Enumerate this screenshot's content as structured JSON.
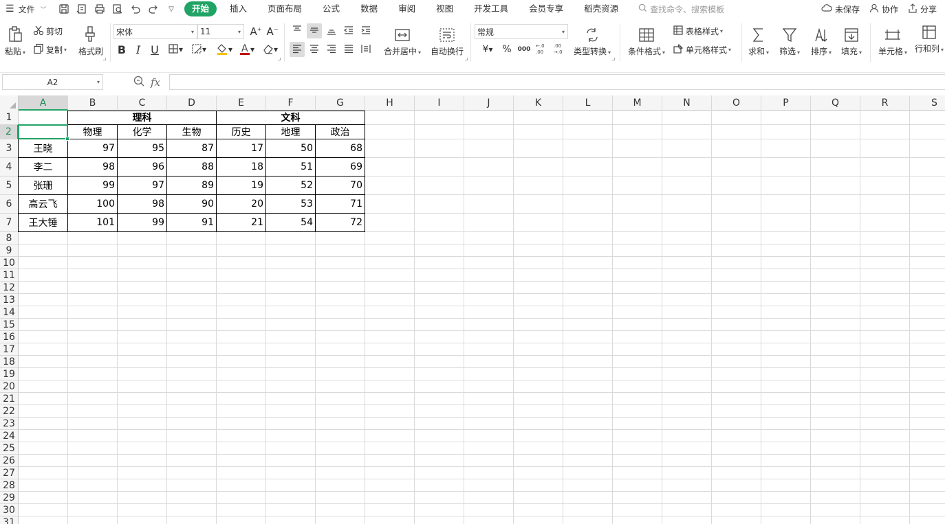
{
  "menubar": {
    "file_label": "文件",
    "tabs": [
      "开始",
      "插入",
      "页面布局",
      "公式",
      "数据",
      "审阅",
      "视图",
      "开发工具",
      "会员专享",
      "稻壳资源"
    ],
    "search_placeholder": "查找命令、搜索模板",
    "unsaved_label": "未保存",
    "collab_label": "协作",
    "share_label": "分享"
  },
  "ribbon": {
    "paste": "粘贴",
    "cut": "剪切",
    "copy": "复制",
    "format_painter": "格式刷",
    "font_name": "宋体",
    "font_size": "11",
    "bold": "B",
    "italic": "I",
    "underline": "U",
    "merge_center": "合并居中",
    "wrap_text": "自动换行",
    "number_format": "常规",
    "currency": "¥",
    "percent": "%",
    "thousands": "000",
    "type_convert": "类型转换",
    "conditional_format": "条件格式",
    "table_style": "表格样式",
    "cell_style": "单元格样式",
    "sum": "求和",
    "filter": "筛选",
    "sort": "排序",
    "fill": "填充",
    "cell": "单元格",
    "row_col": "行和列"
  },
  "formulabar": {
    "name_box": "A2",
    "fx": "fx",
    "formula": ""
  },
  "sheet": {
    "columns": [
      "A",
      "B",
      "C",
      "D",
      "E",
      "F",
      "G",
      "H",
      "I",
      "J",
      "K",
      "L",
      "M",
      "N",
      "O",
      "P",
      "Q",
      "R",
      "S"
    ],
    "rows": [
      "1",
      "2",
      "3",
      "4",
      "5",
      "6",
      "7",
      "8",
      "9",
      "10",
      "11",
      "12",
      "13",
      "14",
      "15",
      "16",
      "17",
      "18",
      "19",
      "20",
      "21",
      "22",
      "23",
      "24",
      "25",
      "26",
      "27",
      "28",
      "29",
      "30",
      "31"
    ],
    "active_cell": "A2",
    "group_headers": {
      "science": "理科",
      "arts": "文科"
    },
    "subject_headers": [
      "物理",
      "化学",
      "生物",
      "历史",
      "地理",
      "政治"
    ],
    "students": [
      {
        "name": "王晓",
        "scores": [
          "97",
          "95",
          "87",
          "17",
          "50",
          "68"
        ]
      },
      {
        "name": "李二",
        "scores": [
          "98",
          "96",
          "88",
          "18",
          "51",
          "69"
        ]
      },
      {
        "name": "张珊",
        "scores": [
          "99",
          "97",
          "89",
          "19",
          "52",
          "70"
        ]
      },
      {
        "name": "高云飞",
        "scores": [
          "100",
          "98",
          "90",
          "20",
          "53",
          "71"
        ]
      },
      {
        "name": "王大锤",
        "scores": [
          "101",
          "99",
          "91",
          "21",
          "54",
          "72"
        ]
      }
    ]
  }
}
